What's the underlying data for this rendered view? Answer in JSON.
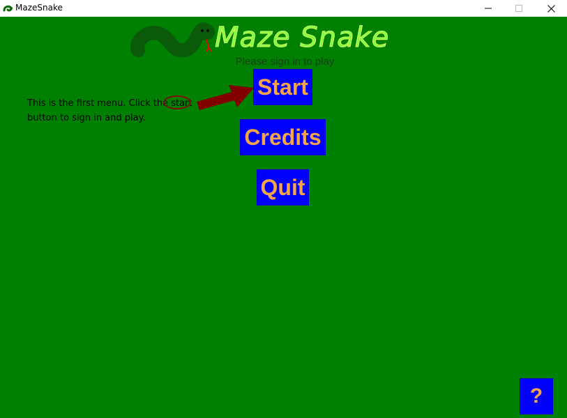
{
  "window": {
    "title": "MazeSnake",
    "controls": [
      "minimize",
      "maximize",
      "close"
    ]
  },
  "game": {
    "logo_text": "Maze Snake",
    "subtitle": "Please sign in to play",
    "menu": {
      "start_label": "Start",
      "credits_label": "Credits",
      "quit_label": "Quit"
    },
    "help_label": "?",
    "tutorial_text": "This is the first menu. Click the start button to sign in and play."
  },
  "colors": {
    "background": "#008000",
    "button_bg": "#0000ff",
    "button_text": "#f5a44a",
    "annotation": "#7a1010",
    "snake": "#0a5a0a"
  }
}
